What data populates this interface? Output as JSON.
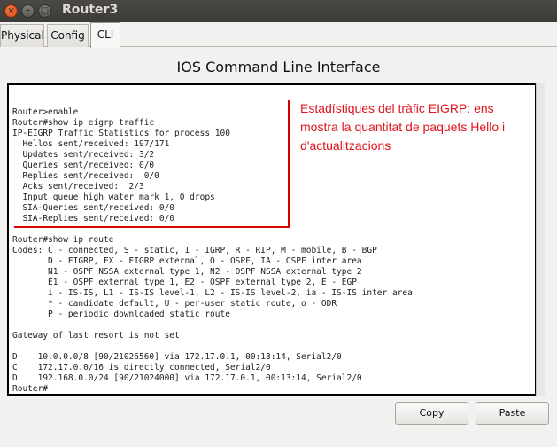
{
  "window": {
    "title": "Router3"
  },
  "tabs": [
    {
      "label": "Physical"
    },
    {
      "label": "Config"
    },
    {
      "label": "CLI"
    }
  ],
  "heading": "IOS Command Line Interface",
  "terminal": {
    "lines": [
      "Router>enable",
      "Router#show ip eigrp traffic",
      "IP-EIGRP Traffic Statistics for process 100",
      "  Hellos sent/received: 197/171",
      "  Updates sent/received: 3/2",
      "  Queries sent/received: 0/0",
      "  Replies sent/received:  0/0",
      "  Acks sent/received:  2/3",
      "  Input queue high water mark 1, 0 drops",
      "  SIA-Queries sent/received: 0/0",
      "  SIA-Replies sent/received: 0/0",
      "",
      "Router#show ip route",
      "Codes: C - connected, S - static, I - IGRP, R - RIP, M - mobile, B - BGP",
      "       D - EIGRP, EX - EIGRP external, O - OSPF, IA - OSPF inter area",
      "       N1 - OSPF NSSA external type 1, N2 - OSPF NSSA external type 2",
      "       E1 - OSPF external type 1, E2 - OSPF external type 2, E - EGP",
      "       i - IS-IS, L1 - IS-IS level-1, L2 - IS-IS level-2, ia - IS-IS inter area",
      "       * - candidate default, U - per-user static route, o - ODR",
      "       P - periodic downloaded static route",
      "",
      "Gateway of last resort is not set",
      "",
      "D    10.0.0.0/8 [90/21026560] via 172.17.0.1, 00:13:14, Serial2/0",
      "C    172.17.0.0/16 is directly connected, Serial2/0",
      "D    192.168.0.0/24 [90/21024000] via 172.17.0.1, 00:13:14, Serial2/0",
      "Router#"
    ]
  },
  "annotation": {
    "text": "Estadístiques del tràfic EIGRP: ens mostra la quantitat de paquets Hello i d'actualitzacions",
    "color": "#e0141c"
  },
  "buttons": {
    "copy": "Copy",
    "paste": "Paste"
  }
}
